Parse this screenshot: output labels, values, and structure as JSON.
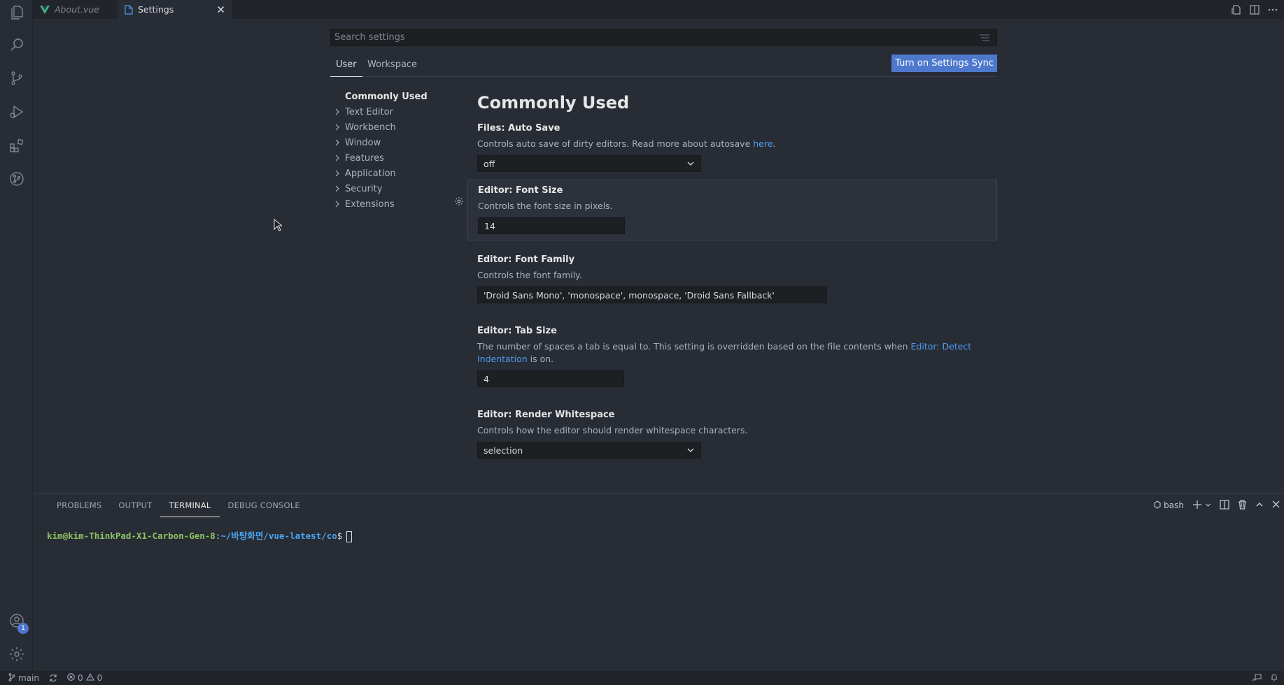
{
  "tabs": [
    {
      "label": "About.vue",
      "icon": "vue-icon",
      "active": false
    },
    {
      "label": "Settings",
      "icon": "file-icon",
      "active": true,
      "close": "✕"
    }
  ],
  "search": {
    "placeholder": "Search settings"
  },
  "scopes": {
    "user": "User",
    "workspace": "Workspace"
  },
  "sync_button": "Turn on Settings Sync",
  "toc": {
    "heading": "Commonly Used",
    "items": [
      "Text Editor",
      "Workbench",
      "Window",
      "Features",
      "Application",
      "Security",
      "Extensions"
    ]
  },
  "section_title": "Commonly Used",
  "settings": {
    "auto_save": {
      "category": "Files: ",
      "name": "Auto Save",
      "desc": "Controls auto save of dirty editors. Read more about autosave ",
      "link": "here",
      "desc_end": ".",
      "value": "off"
    },
    "font_size": {
      "category": "Editor: ",
      "name": "Font Size",
      "desc": "Controls the font size in pixels.",
      "value": "14"
    },
    "font_family": {
      "category": "Editor: ",
      "name": "Font Family",
      "desc": "Controls the font family.",
      "value": "'Droid Sans Mono', 'monospace', monospace, 'Droid Sans Fallback'"
    },
    "tab_size": {
      "category": "Editor: ",
      "name": "Tab Size",
      "desc": "The number of spaces a tab is equal to. This setting is overridden based on the file contents when ",
      "link1": "Editor: Detect",
      "link2": "Indentation",
      "desc_end": " is on.",
      "value": "4"
    },
    "render_ws": {
      "category": "Editor: ",
      "name": "Render Whitespace",
      "desc": "Controls how the editor should render whitespace characters.",
      "value": "selection"
    }
  },
  "panel": {
    "tabs": [
      "PROBLEMS",
      "OUTPUT",
      "TERMINAL",
      "DEBUG CONSOLE"
    ],
    "active_tab": "TERMINAL",
    "shell": "bash",
    "terminal": {
      "user_host": "kim@kim-ThinkPad-X1-Carbon-Gen-8",
      "sep": ":",
      "path": "~/바탕화면/vue-latest/co",
      "dollar": "$"
    }
  },
  "status": {
    "branch": "main",
    "errors": "0",
    "warnings": "0"
  },
  "activity_badge": "1",
  "colors": {
    "accent": "#4d78cc",
    "link": "#4d9bf2",
    "term_user": "#8cc265",
    "term_path": "#4aa5f0"
  }
}
